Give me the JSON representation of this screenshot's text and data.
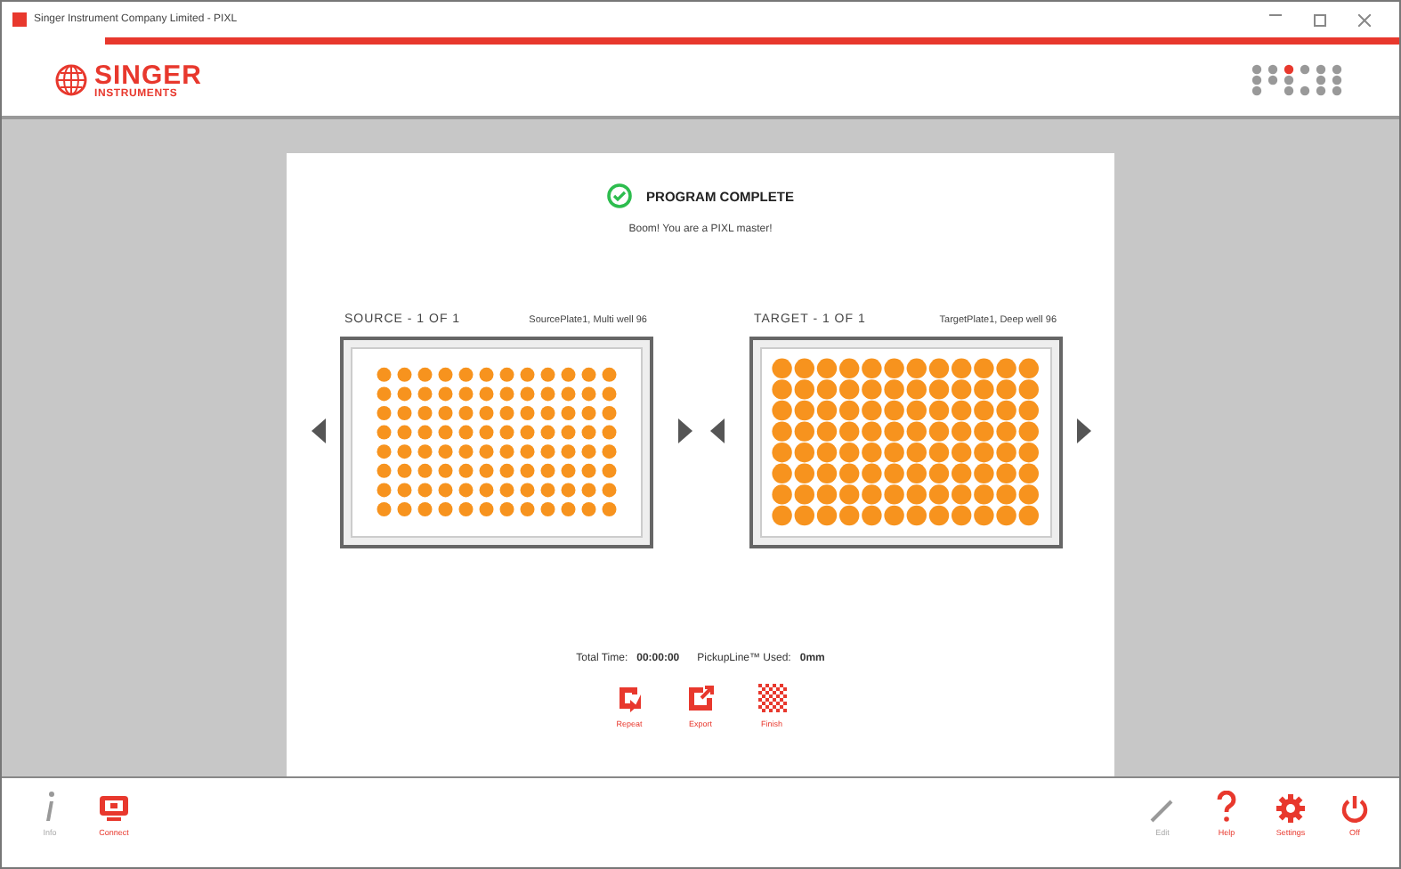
{
  "window": {
    "title": "Singer Instrument Company Limited - PIXL"
  },
  "header": {
    "logo_top": "SINGER",
    "logo_bottom": "INSTRUMENTS"
  },
  "result": {
    "title": "PROGRAM COMPLETE",
    "message": "Boom! You are a PIXL master!"
  },
  "plates": [
    {
      "label": "SOURCE - 1 OF 1",
      "name": "SourcePlate1, Multi well 96",
      "kind": "multi-well"
    },
    {
      "label": "TARGET - 1 OF 1",
      "name": "TargetPlate1, Deep well 96",
      "kind": "deep-well"
    }
  ],
  "summary": [
    {
      "label": "Total Time:",
      "value": "00:00:00"
    },
    {
      "label": "PickupLine™ Used:",
      "value": "0mm"
    }
  ],
  "actions": [
    {
      "label": "Repeat",
      "kind": "repeat"
    },
    {
      "label": "Export",
      "kind": "export"
    },
    {
      "label": "Finish",
      "kind": "finish"
    }
  ],
  "footer": {
    "left": [
      {
        "label": "Info",
        "kind": "info",
        "disabled": true
      },
      {
        "label": "Connect",
        "kind": "connect",
        "disabled": false
      }
    ],
    "right": [
      {
        "label": "Edit",
        "kind": "edit",
        "disabled": true
      },
      {
        "label": "Help",
        "kind": "help",
        "disabled": false
      },
      {
        "label": "Settings",
        "kind": "settings",
        "disabled": false
      },
      {
        "label": "Off",
        "kind": "off",
        "disabled": false
      }
    ]
  }
}
